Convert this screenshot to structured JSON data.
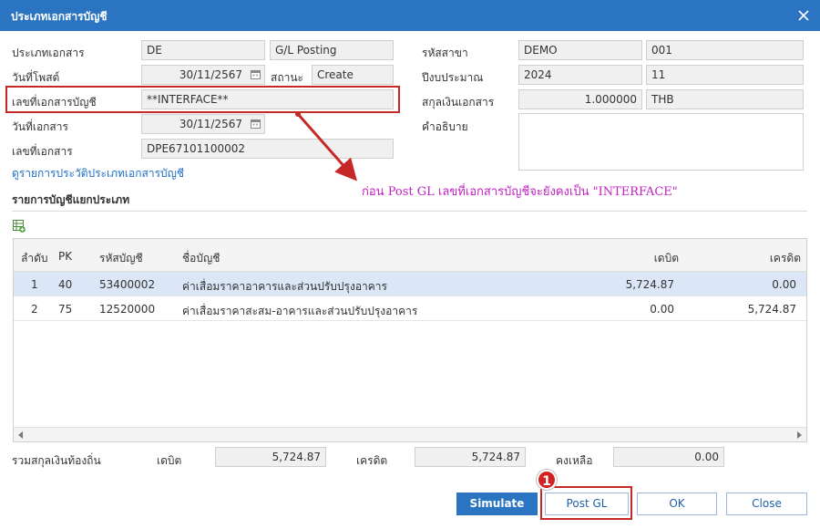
{
  "dialog": {
    "title": "ประเภทเอกสารบัญชี"
  },
  "form": {
    "doc_type_label": "ประเภทเอกสาร",
    "doc_type_code": "DE",
    "doc_type_name": "G/L Posting",
    "post_date_label": "วันที่โพสต์",
    "post_date": "30/11/2567",
    "status_label": "สถานะ",
    "status": "Create",
    "account_doc_no_label": "เลขที่เอกสารบัญชี",
    "account_doc_no": "**INTERFACE**",
    "doc_date_label": "วันที่เอกสาร",
    "doc_date": "30/11/2567",
    "doc_no_label": "เลขที่เอกสาร",
    "doc_no": "DPE67101100002",
    "branch_label": "รหัสสาขา",
    "branch_code": "DEMO",
    "branch_no": "001",
    "fiscal_year_label": "ปีงบประมาณ",
    "fiscal_year": "2024",
    "fiscal_period": "11",
    "currency_label": "สกุลเงินเอกสาร",
    "exchange_rate": "1.000000",
    "currency": "THB",
    "description_label": "คำอธิบาย",
    "description": ""
  },
  "history_link": "ดูรายการประวัติประเภทเอกสารบัญชี",
  "annotation": "ก่อน Post GL เลขที่เอกสารบัญชีจะยังคงเป็น \"INTERFACE\"",
  "grid": {
    "section_title": "รายการบัญชีแยกประเภท",
    "columns": {
      "seq": "ลำดับ",
      "pk": "PK",
      "account_code": "รหัสบัญชี",
      "account_name": "ชื่อบัญชี",
      "debit": "เดบิต",
      "credit": "เครดิต"
    },
    "rows": [
      {
        "seq": "1",
        "pk": "40",
        "account_code": "53400002",
        "account_name": "ค่าเสื่อมราคาอาคารและส่วนปรับปรุงอาคาร",
        "debit": "5,724.87",
        "credit": "0.00"
      },
      {
        "seq": "2",
        "pk": "75",
        "account_code": "12520000",
        "account_name": "ค่าเสื่อมราคาสะสม-อาคารและส่วนปรับปรุงอาคาร",
        "debit": "0.00",
        "credit": "5,724.87"
      }
    ]
  },
  "totals": {
    "label": "รวมสกุลเงินท้องถิ่น",
    "debit_label": "เดบิต",
    "debit": "5,724.87",
    "credit_label": "เครดิต",
    "credit": "5,724.87",
    "balance_label": "คงเหลือ",
    "balance": "0.00"
  },
  "buttons": {
    "simulate": "Simulate",
    "post_gl": "Post GL",
    "ok": "OK",
    "close": "Close"
  },
  "badge": "1",
  "colors": {
    "title_bar": "#2a74c2",
    "highlight": "#c62828",
    "annotation": "#c020c0",
    "selected_row": "#dbe7f6"
  },
  "icons": {
    "close": "close-icon",
    "calendar": "calendar-icon",
    "add_row": "add-row-icon",
    "arrow": "annotation-arrow"
  }
}
